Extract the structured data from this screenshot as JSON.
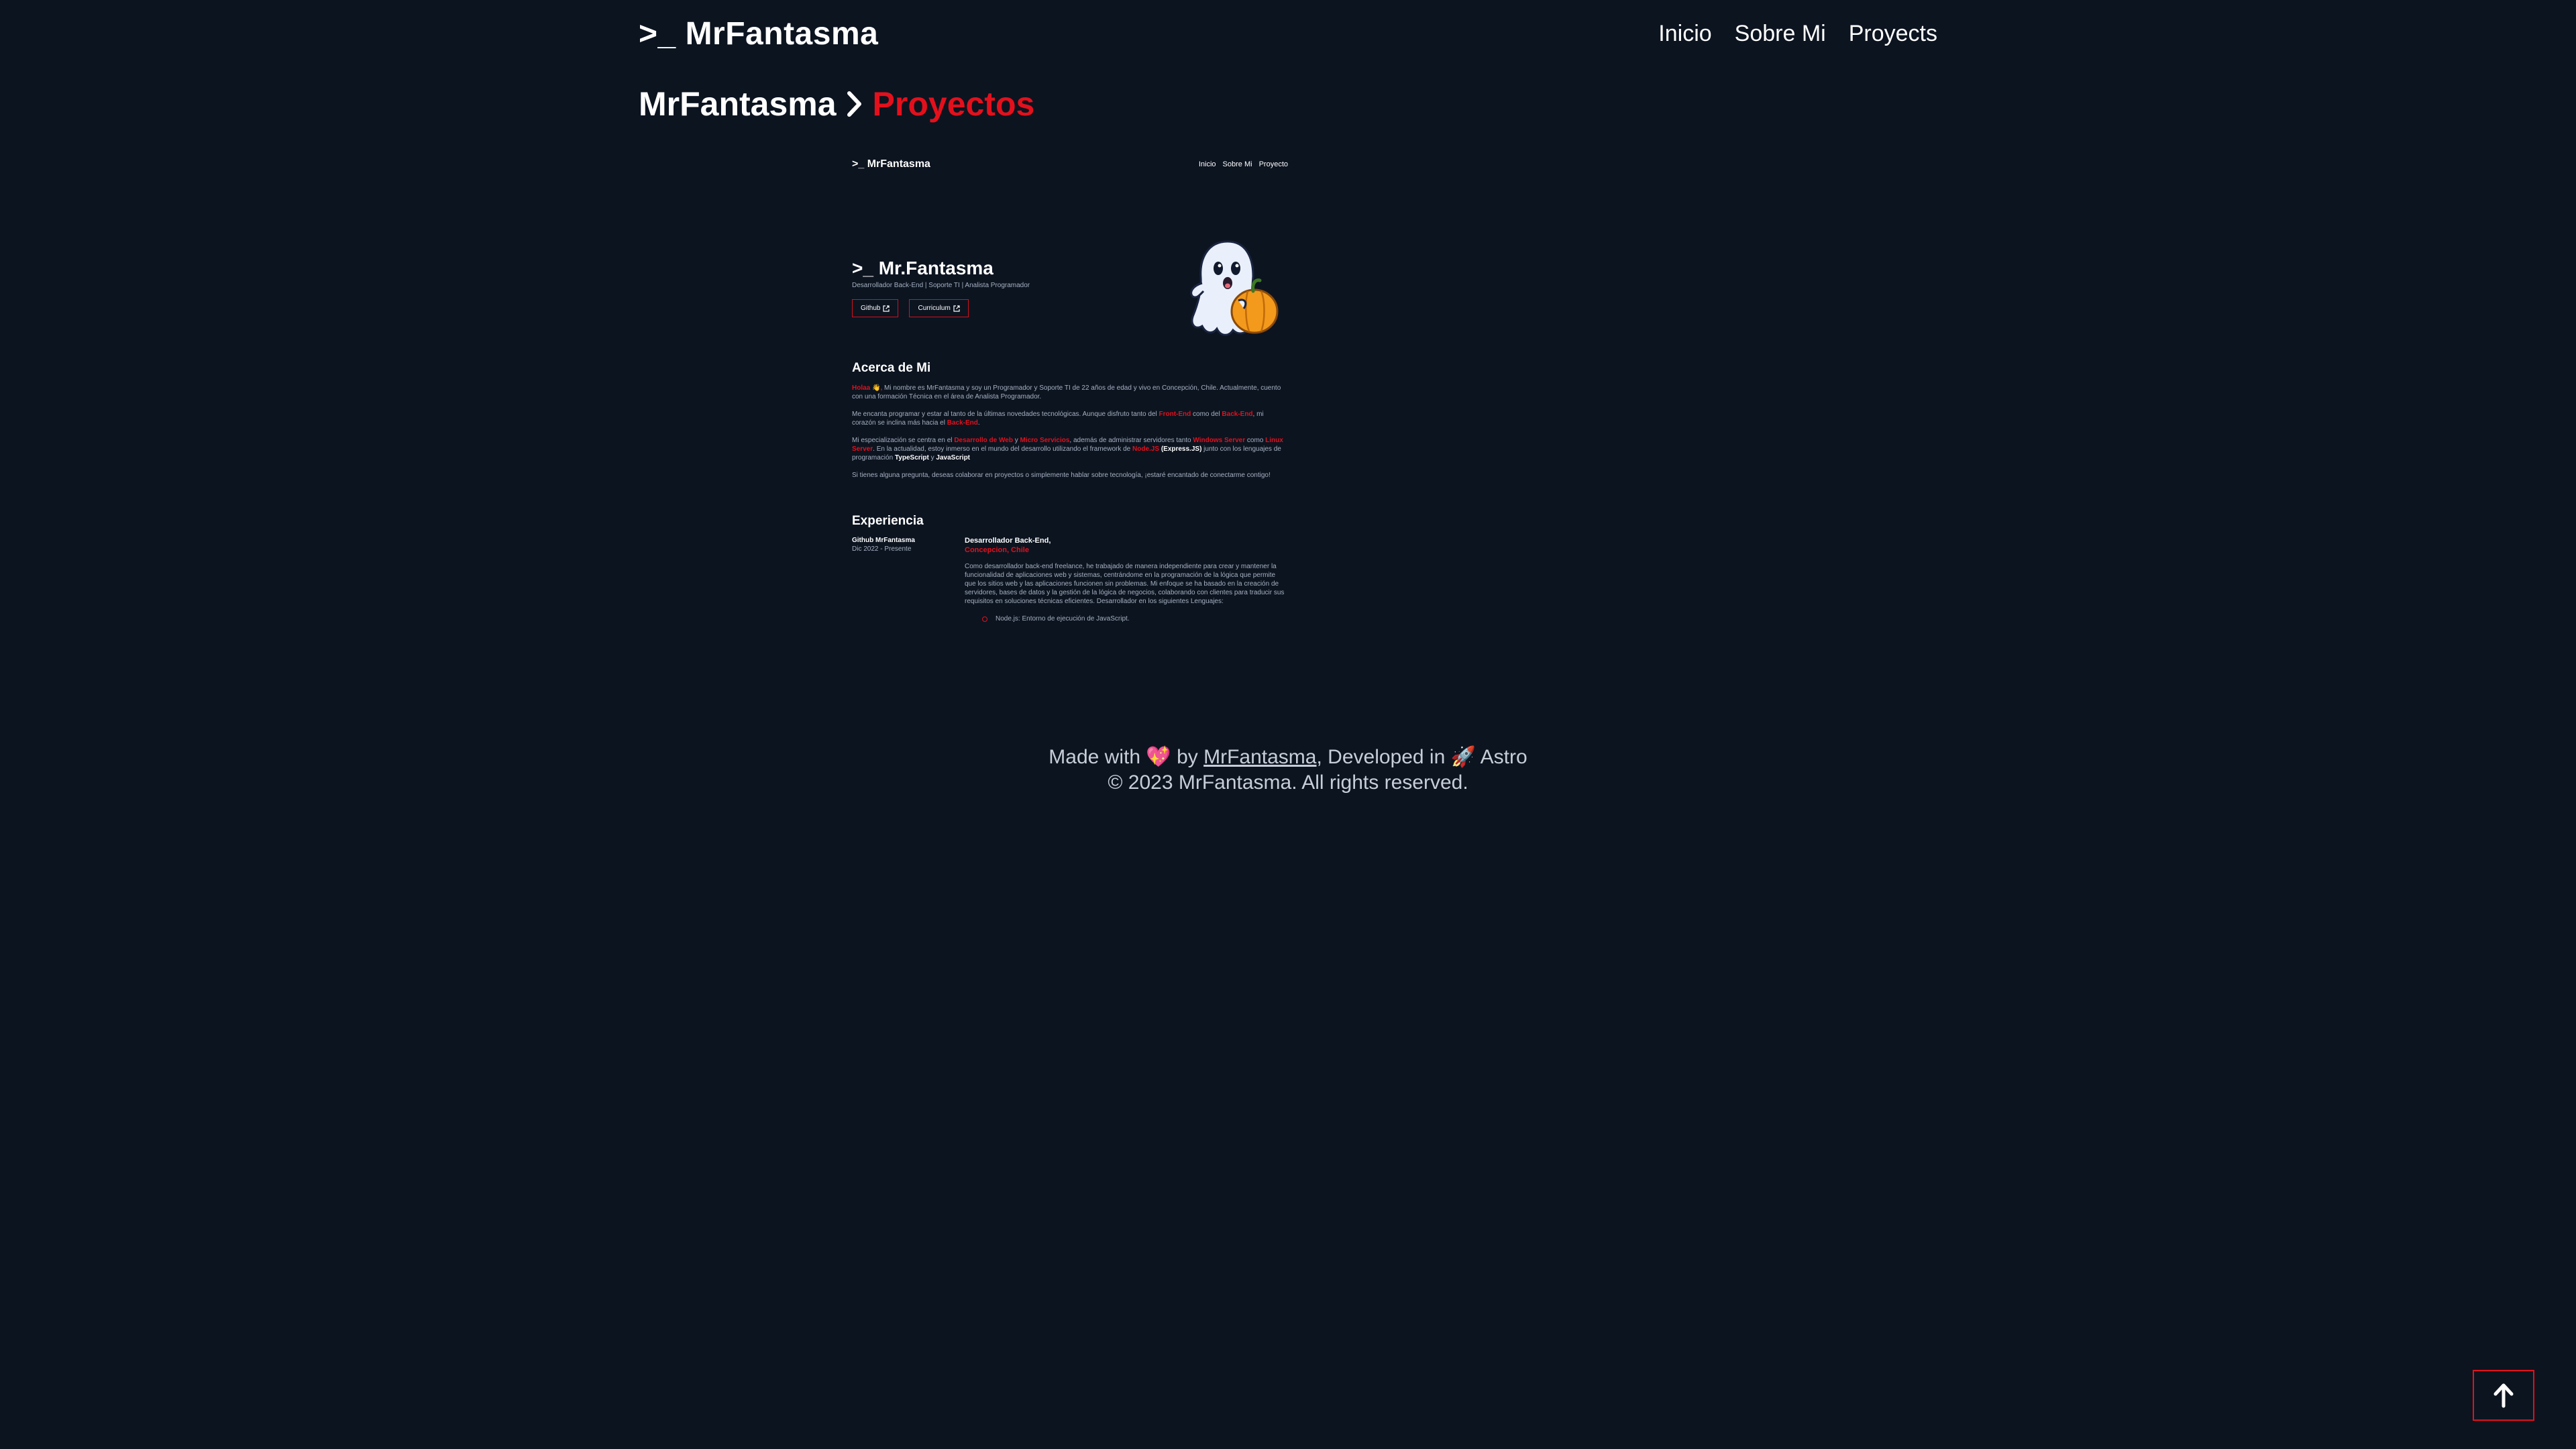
{
  "header": {
    "brand": ">_ MrFantasma",
    "nav": [
      "Inicio",
      "Sobre Mi",
      "Proyects"
    ]
  },
  "breadcrumb": {
    "root": "MrFantasma",
    "current": "Proyectos"
  },
  "preview": {
    "brand": ">_ MrFantasma",
    "nav": [
      "Inicio",
      "Sobre Mi",
      "Proyecto"
    ],
    "hero_title": ">_ Mr.Fantasma",
    "hero_subtitle": "Desarrollador Back-End | Soporte TI | Analista Programador",
    "buttons": [
      "Github",
      "Curriculum"
    ],
    "about_title": "Acerca de Mi",
    "about_p1_hl": "Holaa 👋,",
    "about_p1_rest": " Mi nombre es MrFantasma y soy un Programador y Soporte TI de 22 años de edad y vivo en Concepción, Chile. Actualmente, cuento con una formación Técnica en el área de Analista Programador.",
    "about_p2_a": "Me encanta programar y estar al tanto de la últimas novedades tecnológicas. Aunque disfruto tanto del ",
    "about_p2_hl1": "Front-End",
    "about_p2_b": " como del ",
    "about_p2_hl2": "Back-End",
    "about_p2_c": ", mi corazón se inclina más hacia el ",
    "about_p2_hl3": "Back-End",
    "about_p2_d": ".",
    "about_p3_a": "Mi especialización se centra en el ",
    "about_p3_hl1": "Desarrollo de Web",
    "about_p3_b": " y ",
    "about_p3_hl2": "Micro Servicios",
    "about_p3_c": ", además de administrar servidores tanto ",
    "about_p3_hl3": "Windows Server",
    "about_p3_d": " como ",
    "about_p3_hl4": "Linux Server",
    "about_p3_e": ". En la actualidad, estoy inmerso en el mundo del desarrollo utilizando el framework de ",
    "about_p3_hl5": "Node.JS",
    "about_p3_f": " ",
    "about_p3_wh1": "(Express.JS)",
    "about_p3_g": " junto con los lenguajes de programación ",
    "about_p3_wh2": "TypeScript",
    "about_p3_h": " y ",
    "about_p3_wh3": "JavaScript",
    "about_p4": "Si tienes alguna pregunta, deseas colaborar en proyectos o simplemente hablar sobre tecnología, ¡estaré encantado de conectarme contigo!",
    "exp_title": "Experiencia",
    "exp_company": "Github MrFantasma",
    "exp_date": "Dic 2022 - Presente",
    "exp_role": "Desarrollador Back-End,",
    "exp_location": "Concepcion, Chile",
    "exp_desc": "Como desarrollador back-end freelance, he trabajado de manera independiente para crear y mantener la funcionalidad de aplicaciones web y sistemas, centrándome en la programación de la lógica que permite que los sitios web y las aplicaciones funcionen sin problemas. Mi enfoque se ha basado en la creación de servidores, bases de datos y la gestión de la lógica de negocios, colaborando con clientes para traducir sus requisitos en soluciones técnicas eficientes. Desarrollador en los siguientes Lenguajes:",
    "exp_item": "Node.js: Entorno de ejecución de JavaScript."
  },
  "footer": {
    "made_with": "Made with",
    "heart": "💖",
    "by": "by",
    "author": "MrFantasma",
    "developed_in": ", Developed in",
    "rocket": "🚀",
    "framework": "Astro",
    "copyright": "© 2023 MrFantasma. All rights reserved."
  },
  "colors": {
    "background": "#0c1420",
    "accent": "#e3101c",
    "text": "#ffffff",
    "muted": "#a6b0c0"
  },
  "icons": {
    "breadcrumb_separator": "chevron-right-icon",
    "external_link": "external-link-icon",
    "back_to_top": "arrow-up-icon"
  }
}
